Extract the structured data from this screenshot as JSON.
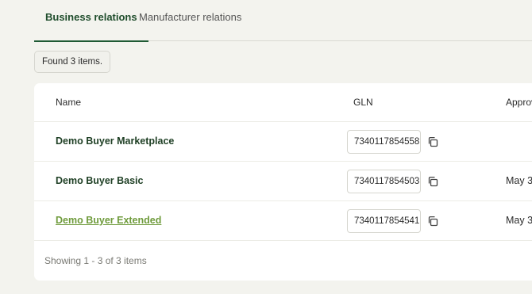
{
  "tabs": [
    {
      "label": "Business relations",
      "active": true
    },
    {
      "label": "Manufacturer relations",
      "active": false
    }
  ],
  "found_text": "Found 3 items.",
  "table": {
    "columns": [
      "Name",
      "GLN",
      "Approv"
    ],
    "rows": [
      {
        "name": "Demo Buyer Marketplace",
        "gln": "7340117854558",
        "approved": "",
        "link": false
      },
      {
        "name": "Demo Buyer Basic",
        "gln": "7340117854503",
        "approved": "May 3",
        "link": false
      },
      {
        "name": "Demo Buyer Extended",
        "gln": "7340117854541",
        "approved": "May 3",
        "link": true
      }
    ]
  },
  "footer_text": "Showing 1 - 3 of 3 items",
  "colors": {
    "background": "#f3f3ee",
    "accent": "#1f5a34",
    "link": "#6f9b3c"
  },
  "icons": {
    "copy": "copy-icon"
  }
}
